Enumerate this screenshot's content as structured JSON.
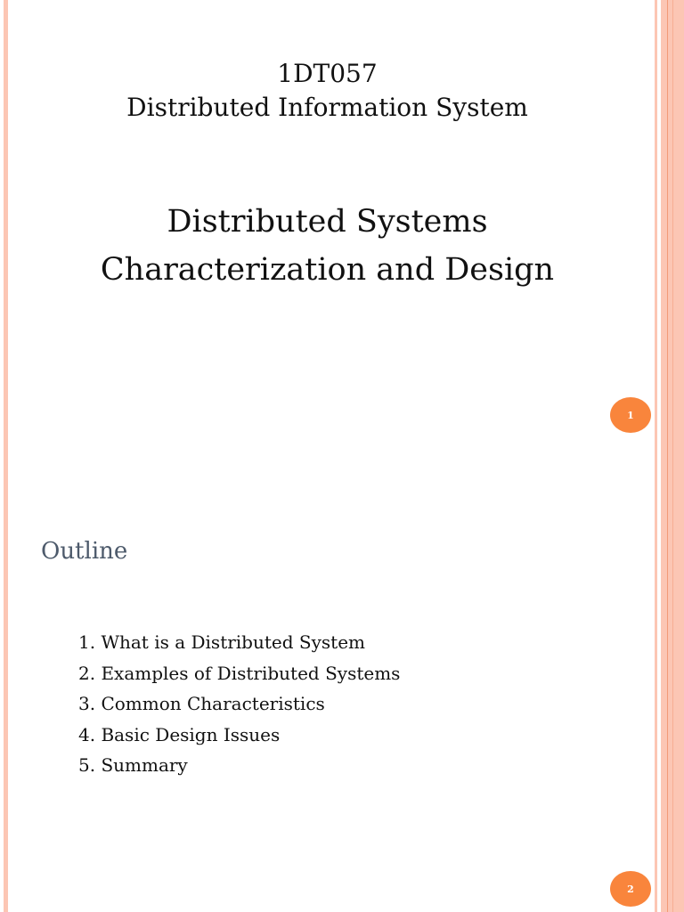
{
  "slides": [
    {
      "course_code": "1DT057",
      "course_name": "Distributed Information System",
      "title_line1": "Distributed Systems",
      "title_line2": "Characterization and Design",
      "slide_number": "1"
    },
    {
      "heading": "Outline",
      "items": [
        "1. What is a Distributed System",
        "2. Examples of Distributed Systems",
        "3. Common Characteristics",
        "4. Basic Design Issues",
        "5. Summary"
      ],
      "slide_number": "2"
    }
  ],
  "colors": {
    "accent": "#f9853c",
    "border": "#fcc6b4",
    "heading": "#4d5a6b"
  }
}
